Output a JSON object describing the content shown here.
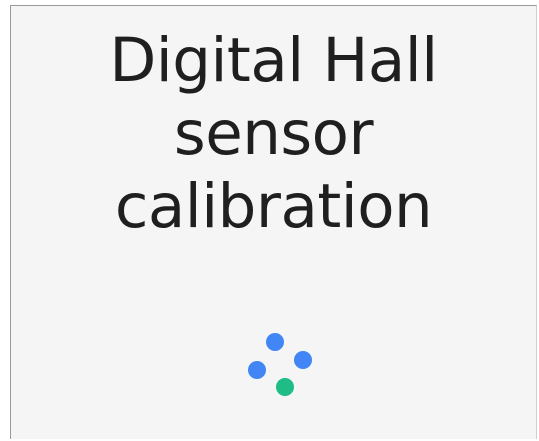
{
  "screen": {
    "title_lines": [
      "Digital Hall",
      "sensor",
      "calibration"
    ]
  },
  "loader": {
    "icon": "loading-dots-icon",
    "colors": {
      "dot1": "#4285f4",
      "dot2": "#4285f4",
      "dot3": "#4285f4",
      "dot4": "#1fbc86"
    }
  }
}
